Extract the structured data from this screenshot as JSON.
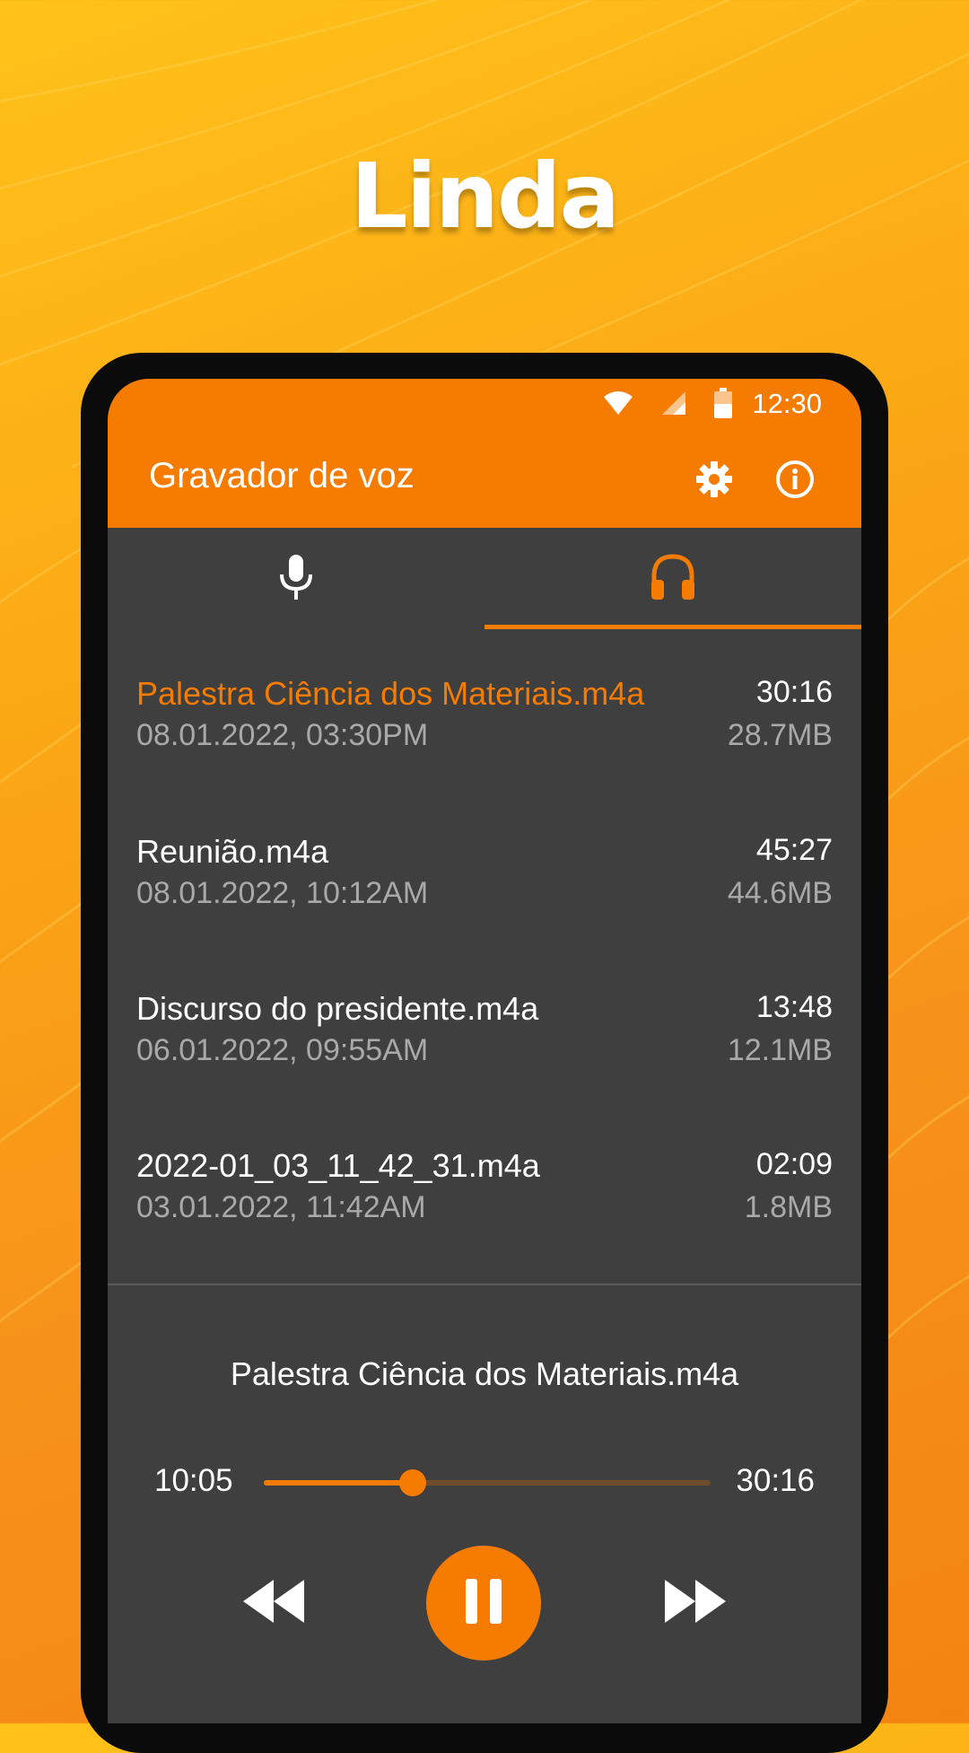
{
  "headline": "Linda",
  "status_bar": {
    "time": "12:30",
    "icons": [
      "wifi-icon",
      "cellular-signal-icon",
      "battery-icon"
    ]
  },
  "app_bar": {
    "title": "Gravador de voz",
    "actions": [
      "settings-gear-icon",
      "info-icon"
    ]
  },
  "tabs": [
    {
      "icon": "microphone-icon",
      "selected": false
    },
    {
      "icon": "headphones-icon",
      "selected": true
    }
  ],
  "recordings": [
    {
      "name": "Palestra Ciência dos Materiais.m4a",
      "date": "08.01.2022, 03:30PM",
      "duration": "30:16",
      "size": "28.7MB",
      "active": true
    },
    {
      "name": "Reunião.m4a",
      "date": "08.01.2022, 10:12AM",
      "duration": "45:27",
      "size": "44.6MB",
      "active": false
    },
    {
      "name": "Discurso do presidente.m4a",
      "date": "06.01.2022, 09:55AM",
      "duration": "13:48",
      "size": "12.1MB",
      "active": false
    },
    {
      "name": "2022-01_03_11_42_31.m4a",
      "date": "03.01.2022, 11:42AM",
      "duration": "02:09",
      "size": "1.8MB",
      "active": false
    }
  ],
  "player": {
    "title": "Palestra Ciência dos Materiais.m4a",
    "elapsed": "10:05",
    "total": "30:16",
    "progress": 0.333,
    "controls": [
      "rewind-icon",
      "pause-icon",
      "fast-forward-icon"
    ]
  },
  "colors": {
    "accent": "#f57c00",
    "surface": "#3f3f3f",
    "secondary_text": "#a9a9a9"
  }
}
